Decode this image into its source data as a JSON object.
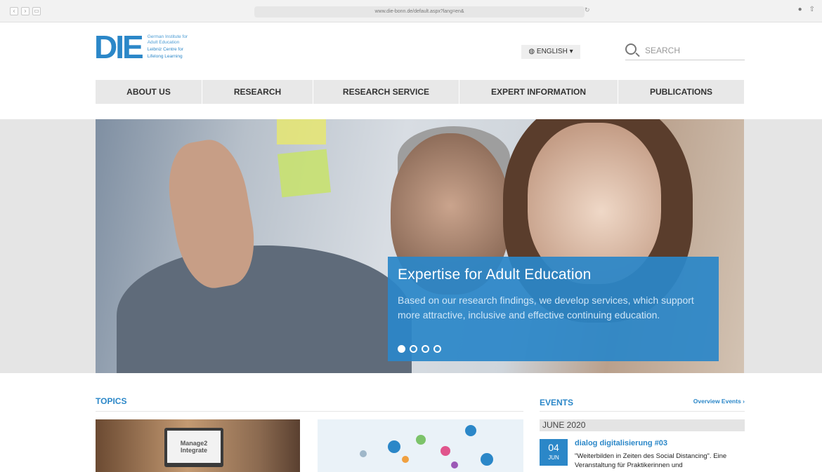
{
  "browser": {
    "url": "www.die-bonn.de/default.aspx?lang=en&",
    "nav_icons": [
      "back-icon",
      "forward-icon",
      "sidebar-icon"
    ]
  },
  "header": {
    "logo_mark": "DIE",
    "logo_line1": "German Institute for",
    "logo_line2": "Adult Education",
    "logo_line3": "Leibniz Centre for",
    "logo_line4": "Lifelong Learning",
    "language": "ENGLISH ▾",
    "search_placeholder": "SEARCH"
  },
  "nav": {
    "items": [
      {
        "label": "ABOUT US"
      },
      {
        "label": "RESEARCH"
      },
      {
        "label": "RESEARCH SERVICE"
      },
      {
        "label": "EXPERT INFORMATION"
      },
      {
        "label": "PUBLICATIONS"
      }
    ]
  },
  "hero": {
    "title": "Expertise for Adult Education",
    "text": "Based on our research findings, we develop services, which support more attractive, inclusive and effective continuing education.",
    "slides_total": 4,
    "active_slide": 1
  },
  "topics": {
    "heading": "TOPICS",
    "card1_logo": "Manage2 Integrate"
  },
  "events": {
    "heading": "EVENTS",
    "overview_link": "Overview Events ›",
    "month": "JUNE 2020",
    "event": {
      "day": "04",
      "month": "JUN",
      "title": "dialog digitalisierung #03",
      "description": "\"Weiterbilden in Zeiten des Social Distancing\". Eine Veranstaltung für Praktikerinnen und"
    }
  },
  "colors": {
    "accent": "#2b87c8",
    "nav_bg": "#e8e8e8"
  }
}
